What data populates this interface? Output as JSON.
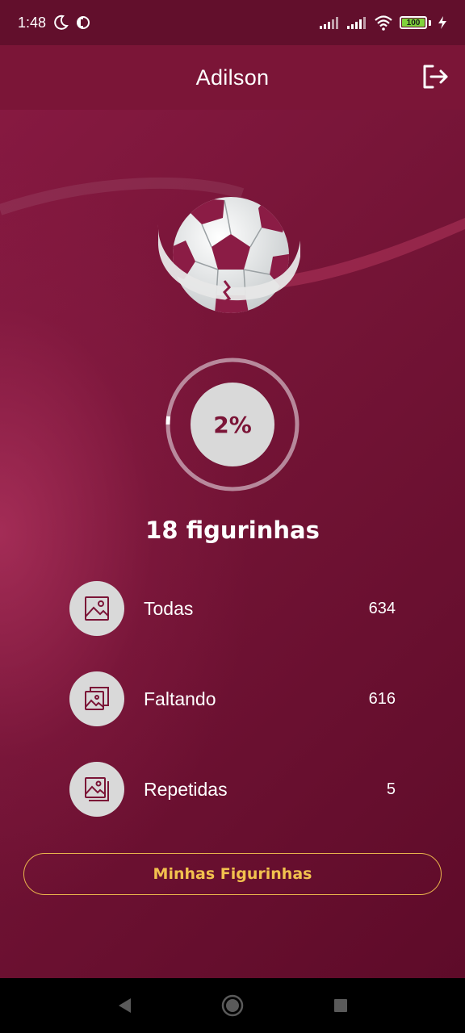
{
  "status_bar": {
    "time": "1:48",
    "battery": "100",
    "icons": [
      "moon-icon",
      "data-saver-icon",
      "signal-icon",
      "signal-icon",
      "wifi-icon",
      "battery-icon",
      "charging-icon"
    ]
  },
  "app_bar": {
    "title": "Adilson",
    "logout_icon": "logout-icon"
  },
  "progress": {
    "label": "2%",
    "fraction": 0.02
  },
  "count_title": "18 figurinhas",
  "stats": [
    {
      "label": "Todas",
      "value": "634",
      "icon": "image-icon"
    },
    {
      "label": "Faltando",
      "value": "616",
      "icon": "images-stack-icon"
    },
    {
      "label": "Repetidas",
      "value": "5",
      "icon": "images-duplicate-icon"
    }
  ],
  "button": {
    "label": "Minhas Figurinhas"
  },
  "colors": {
    "primary": "#7b1537",
    "accent": "#e9b44c",
    "circle_fill": "#d9d9d9"
  },
  "nav": {
    "icons": [
      "back-icon",
      "home-icon",
      "recents-icon"
    ]
  }
}
